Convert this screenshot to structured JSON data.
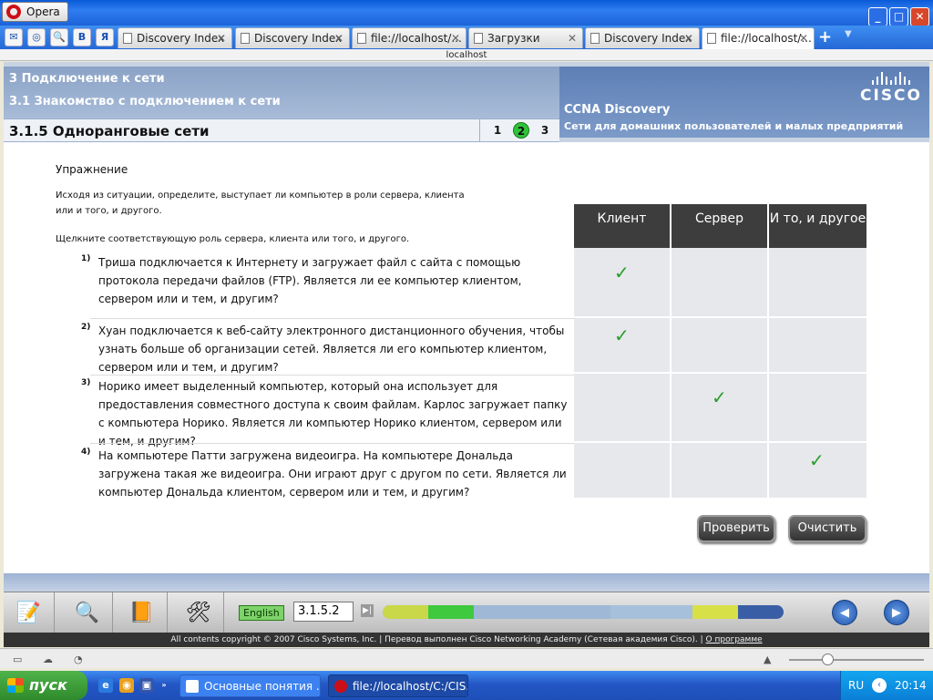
{
  "browser": {
    "menu_label": "Opera",
    "address": "localhost",
    "tabs": [
      {
        "label": "Discovery Index"
      },
      {
        "label": "Discovery Index"
      },
      {
        "label": "file://localhost/..."
      },
      {
        "label": "Загрузки"
      },
      {
        "label": "Discovery Index"
      },
      {
        "label": "file://localhost/..."
      }
    ],
    "quick_icons": [
      "mail-icon",
      "opera-icon",
      "search-icon",
      "vk-icon",
      "yandex-icon"
    ],
    "quick_icon_glyphs": [
      "✉",
      "◎",
      "🔍",
      "В",
      "Я"
    ]
  },
  "header": {
    "chapter": "3 Подключение к сети",
    "section": "3.1 Знакомство с подключением к сети",
    "topic": "3.1.5 Одноранговые сети",
    "pages": [
      "1",
      "2",
      "3"
    ],
    "current_page": "2",
    "course": "CCNA Discovery",
    "course_sub": "Сети для домашних пользователей и малых предприятий",
    "logo": "CISCO"
  },
  "exercise": {
    "title": "Упражнение",
    "instruction": "Исходя из ситуации, определите, выступает ли компьютер в роли сервера, клиента или и того, и другого.",
    "click_prompt": "Щелкните соответствующую роль сервера, клиента или того, и другого.",
    "columns": [
      "Клиент",
      "Сервер",
      "И то, и другое"
    ],
    "questions": [
      {
        "num": "1)",
        "text": "Триша подключается к Интернету и загружает файл с сайта с помощью протокола передачи файлов (FTP). Является ли ее компьютер клиентом, сервером или и тем, и другим?",
        "answer": 0
      },
      {
        "num": "2)",
        "text": "Хуан подключается к веб-сайту электронного дистанционного обучения, чтобы узнать больше об организации сетей. Является ли его компьютер клиентом, сервером или и тем, и другим?",
        "answer": 0
      },
      {
        "num": "3)",
        "text": "Норико имеет выделенный компьютер, который она использует для предоставления совместного доступа к своим файлам. Карлос загружает папку с компьютера Норико. Является ли компьютер Норико клиентом, сервером или и тем, и другим?",
        "answer": 1
      },
      {
        "num": "4)",
        "text": "На компьютере Патти загружена видеоигра. На компьютере Дональда загружена такая же видеоигра. Они играют друг с другом по сети. Является ли компьютер Дональда клиентом, сервером или и тем, и другим?",
        "answer": 2
      }
    ],
    "check_mark": "✓",
    "check_button": "Проверить",
    "clear_button": "Очистить"
  },
  "toolbar": {
    "language": "English",
    "page_value": "3.1.5.2",
    "go": "▶|",
    "progress_colors": [
      "#c9d848",
      "#3ec93e",
      "#9fb8d6",
      "#9fb8d6",
      "#a6c0dc",
      "#d8e048",
      "#3a5ea6"
    ],
    "tool_icons": [
      "notes-icon",
      "magnifier-icon",
      "book-icon",
      "tools-icon"
    ],
    "tool_glyphs": [
      "📝",
      "🔍",
      "📙",
      "🛠"
    ],
    "prev": "◀",
    "next": "▶"
  },
  "footer": {
    "copyright": "All contents copyright © 2007 Cisco Systems, Inc. | Перевод выполнен Cisco Networking Academy (Сетевая академия Cisco). | ",
    "about_link": "О программе"
  },
  "taskbar": {
    "start": "пуск",
    "tasks": [
      "Основные понятия ...",
      "file://localhost/C:/CIS..."
    ],
    "lang": "RU",
    "time": "20:14"
  }
}
